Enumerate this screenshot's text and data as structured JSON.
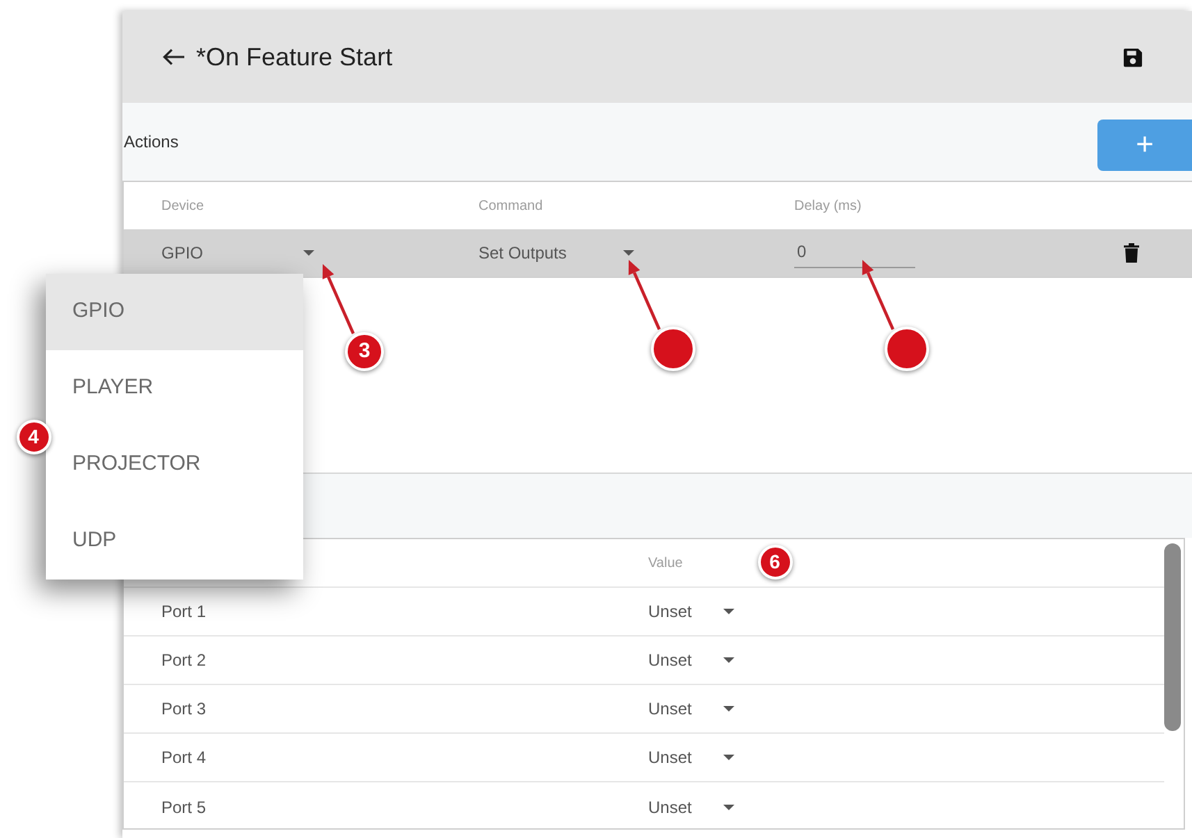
{
  "header": {
    "title": "*On Feature Start"
  },
  "actions": {
    "title": "Actions",
    "add_label": "+",
    "columns": [
      "Device",
      "Command",
      "Delay (ms)"
    ],
    "rows": [
      {
        "device": "GPIO",
        "command": "Set Outputs",
        "delay": "0",
        "selected": true
      }
    ]
  },
  "outputs": {
    "value_column_header": "Value",
    "rows": [
      {
        "port": "Port 1",
        "value": "Unset"
      },
      {
        "port": "Port 2",
        "value": "Unset"
      },
      {
        "port": "Port 3",
        "value": "Unset"
      },
      {
        "port": "Port 4",
        "value": "Unset"
      },
      {
        "port": "Port 5",
        "value": "Unset"
      }
    ]
  },
  "device_menu": {
    "items": [
      {
        "label": "GPIO",
        "selected": true
      },
      {
        "label": "PLAYER",
        "selected": false
      },
      {
        "label": "PROJECTOR",
        "selected": false
      },
      {
        "label": "UDP",
        "selected": false
      }
    ]
  },
  "callouts": [
    {
      "kind": "numbered",
      "label": "3",
      "arrow": true
    },
    {
      "kind": "blank",
      "arrow": true
    },
    {
      "kind": "blank",
      "arrow": true
    },
    {
      "kind": "numbered",
      "label": "4",
      "arrow": false
    },
    {
      "kind": "numbered",
      "label": "6",
      "arrow": false
    }
  ]
}
